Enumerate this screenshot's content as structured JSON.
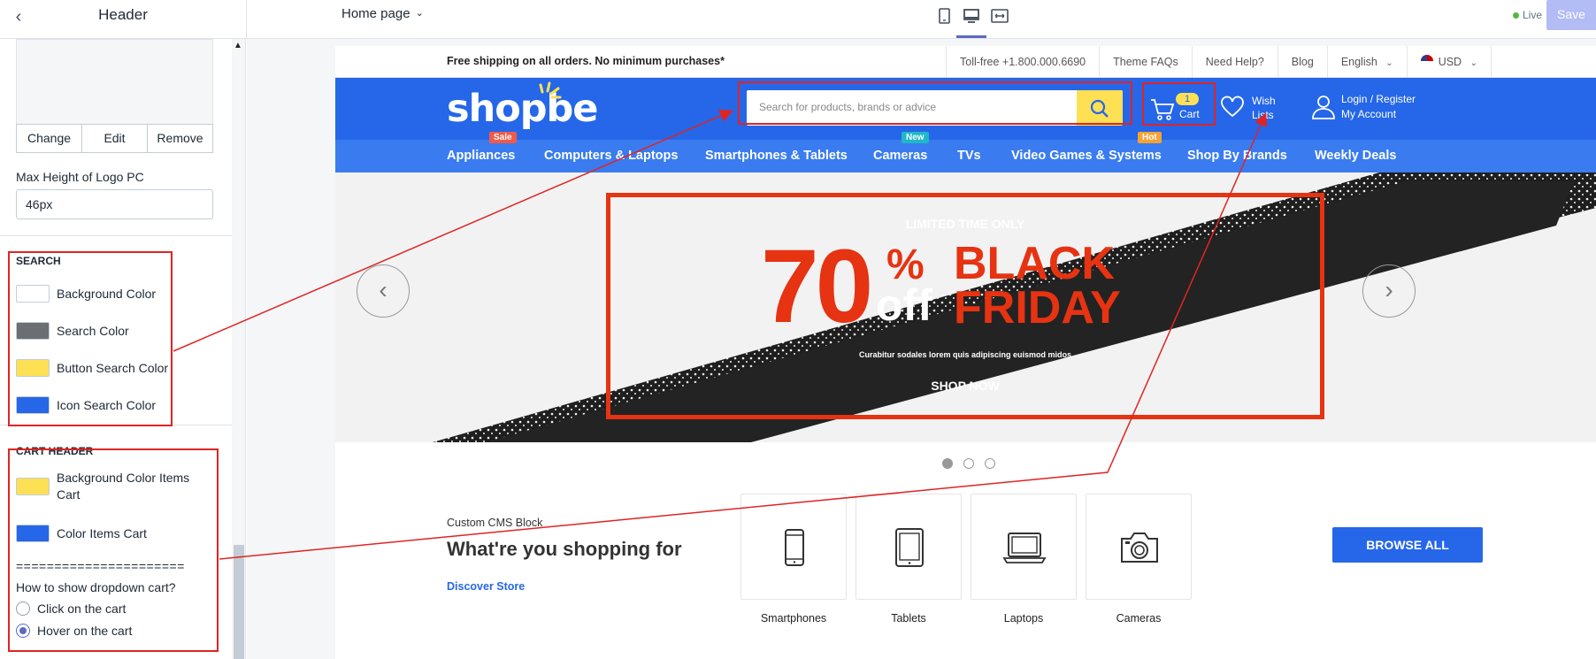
{
  "topbar": {
    "back_icon": "chevron-left-icon",
    "title": "Header",
    "page_select": "Home page",
    "devices": [
      "mobile-icon",
      "desktop-icon",
      "fullwidth-icon"
    ],
    "active_device": "desktop",
    "live_label": "Live",
    "save_label": "Save"
  },
  "sidebar": {
    "logo_buttons": [
      "Change",
      "Edit",
      "Remove"
    ],
    "max_height_label": "Max Height of Logo PC",
    "max_height_value": "46px",
    "search": {
      "heading": "SEARCH",
      "items": [
        {
          "label": "Background Color",
          "color": "#ffffff"
        },
        {
          "label": "Search Color",
          "color": "#6b6f73"
        },
        {
          "label": "Button Search Color",
          "color": "#fde053"
        },
        {
          "label": "Icon Search Color",
          "color": "#2567e8"
        }
      ]
    },
    "cart": {
      "heading": "CART HEADER",
      "items": [
        {
          "label": "Background Color Items Cart",
          "color": "#fde053"
        },
        {
          "label": "Color Items Cart",
          "color": "#2567e8"
        }
      ],
      "divider": "======================",
      "dropdown_question": "How to show dropdown cart?",
      "options": [
        {
          "label": "Click on the cart",
          "selected": false
        },
        {
          "label": "Hover on the cart",
          "selected": true
        }
      ]
    }
  },
  "site": {
    "announcement": "Free shipping on all orders. No minimum purchases*",
    "top_links": [
      "Toll-free +1.800.000.6690",
      "Theme FAQs",
      "Need Help?",
      "Blog",
      "English",
      "USD"
    ],
    "logo": "shopbe",
    "search_placeholder": "Search for products, brands or advice",
    "cart_count": "1",
    "cart_label": "Cart",
    "wish_label_1": "Wish",
    "wish_label_2": "Lists",
    "account_1": "Login / Register",
    "account_2": "My Account",
    "nav": [
      {
        "label": "Appliances",
        "tag": "Sale",
        "tag_color": "#f15a4a"
      },
      {
        "label": "Computers & Laptops",
        "tag": "",
        "tag_color": ""
      },
      {
        "label": "Smartphones & Tablets",
        "tag": "",
        "tag_color": ""
      },
      {
        "label": "Cameras",
        "tag": "New",
        "tag_color": "#1fb8c9"
      },
      {
        "label": "TVs",
        "tag": "",
        "tag_color": ""
      },
      {
        "label": "Video Games & Systems",
        "tag": "Hot",
        "tag_color": "#f7a234"
      },
      {
        "label": "Shop By Brands",
        "tag": "",
        "tag_color": ""
      },
      {
        "label": "Weekly Deals",
        "tag": "",
        "tag_color": ""
      }
    ],
    "hero": {
      "kicker": "LIMITED TIME ONLY",
      "big": "70",
      "pct": "%",
      "off": "off",
      "line1": "BLACK",
      "line2": "FRIDAY",
      "sub": "Curabitur sodales lorem quis adipiscing euismod midos",
      "cta": "SHOP NOW",
      "slides": 3,
      "active_slide": 1
    },
    "cms_label": "Custom CMS Block",
    "cms_heading": "What're you shopping for",
    "cms_link": "Discover Store",
    "categories": [
      {
        "label": "Smartphones",
        "icon": "smartphone-icon"
      },
      {
        "label": "Tablets",
        "icon": "tablet-icon"
      },
      {
        "label": "Laptops",
        "icon": "laptop-icon"
      },
      {
        "label": "Cameras",
        "icon": "camera-icon"
      }
    ],
    "browse_all": "BROWSE ALL"
  },
  "colors": {
    "brand_blue": "#2567e8",
    "nav_blue": "#3a7cf0",
    "yellow": "#fde053",
    "promo_red": "#e63312",
    "annotation_red": "#e02424",
    "accent": "#5c6ac4"
  }
}
